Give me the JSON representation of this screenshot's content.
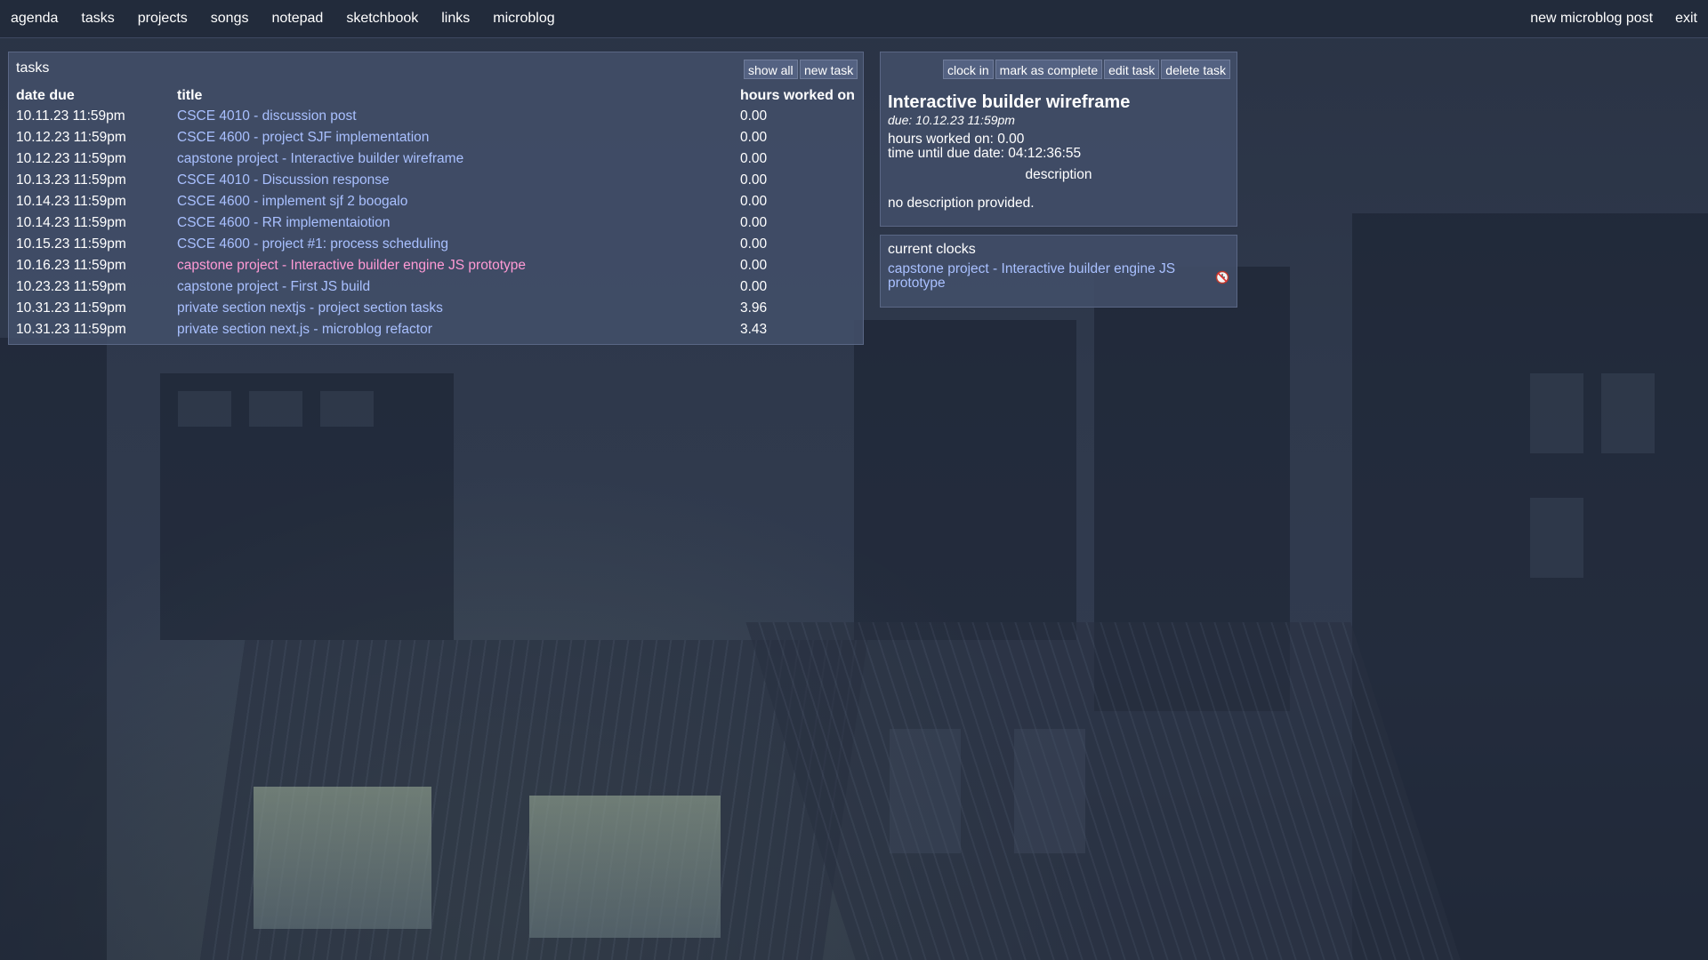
{
  "nav": {
    "left": [
      "agenda",
      "tasks",
      "projects",
      "songs",
      "notepad",
      "sketchbook",
      "links",
      "microblog"
    ],
    "right": [
      "new microblog post",
      "exit"
    ]
  },
  "tasks_panel": {
    "title": "tasks",
    "show_all_label": "show all",
    "new_task_label": "new task",
    "columns": [
      "date due",
      "title",
      "hours worked on"
    ],
    "rows": [
      {
        "date": "10.11.23 11:59pm",
        "title": "CSCE 4010 - discussion post",
        "hours": "0.00"
      },
      {
        "date": "10.12.23 11:59pm",
        "title": "CSCE 4600 - project SJF implementation",
        "hours": "0.00"
      },
      {
        "date": "10.12.23 11:59pm",
        "title": "capstone project - Interactive builder wireframe",
        "hours": "0.00"
      },
      {
        "date": "10.13.23 11:59pm",
        "title": "CSCE 4010 - Discussion response",
        "hours": "0.00"
      },
      {
        "date": "10.14.23 11:59pm",
        "title": "CSCE 4600 - implement sjf 2 boogalo",
        "hours": "0.00"
      },
      {
        "date": "10.14.23 11:59pm",
        "title": "CSCE 4600 - RR implementaiotion",
        "hours": "0.00"
      },
      {
        "date": "10.15.23 11:59pm",
        "title": "CSCE 4600 - project #1: process scheduling",
        "hours": "0.00"
      },
      {
        "date": "10.16.23 11:59pm",
        "title": "capstone project - Interactive builder engine JS prototype",
        "hours": "0.00"
      },
      {
        "date": "10.23.23 11:59pm",
        "title": "capstone project - First JS build",
        "hours": "0.00"
      },
      {
        "date": "10.31.23 11:59pm",
        "title": "private section nextjs - project section tasks",
        "hours": "3.96"
      },
      {
        "date": "10.31.23 11:59pm",
        "title": "private section next.js - microblog refactor",
        "hours": "3.43"
      }
    ],
    "active_row_index": 7
  },
  "detail_panel": {
    "clock_in_label": "clock in",
    "mark_complete_label": "mark as complete",
    "edit_label": "edit task",
    "delete_label": "delete task",
    "title": "Interactive builder wireframe",
    "due": "due: 10.12.23 11:59pm",
    "hours_worked": "hours worked on: 0.00",
    "time_until_due": "time until due date: 04:12:36:55",
    "description_heading": "description",
    "description": "no description provided."
  },
  "clocks_panel": {
    "title": "current clocks",
    "clock_text": "capstone project - Interactive builder engine JS prototype",
    "stop_icon": "stop-clock-icon"
  },
  "colors": {
    "link": "#a9c0ff",
    "active_link": "#ff9ad5",
    "panel": "#424e69",
    "topbar": "#222b3b"
  }
}
